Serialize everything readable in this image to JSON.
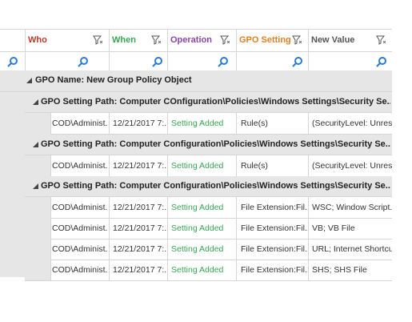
{
  "columns": [
    {
      "label": "Who",
      "color": "#c0392b"
    },
    {
      "label": "When",
      "color": "#3aa655"
    },
    {
      "label": "Operation",
      "color": "#8e44ad"
    },
    {
      "label": "GPO Setting",
      "color": "#e67e22"
    },
    {
      "label": "New Value",
      "color": "#555555"
    }
  ],
  "groups": {
    "gpo_name": "GPO Name: New Group Policy Object",
    "path1": "GPO Setting Path: Computer COnfiguration\\Policies\\Windows Settings\\Security Se...",
    "path2": "GPO Setting Path: Computer Configuration\\Policies\\Windows Settings\\Security Se...",
    "path3": "GPO Setting Path: Computer Configuration\\Policies\\Windows Settings\\Security Se..."
  },
  "rows": [
    {
      "who": "COD\\Administ..",
      "when": "12/21/2017 7:..",
      "operation": "Setting Added",
      "setting": "Rule(s)",
      "value": "(SecurityLevel: Unres..."
    },
    {
      "who": "COD\\Administ..",
      "when": "12/21/2017 7:..",
      "operation": "Setting Added",
      "setting": "Rule(s)",
      "value": "(SecurityLevel: Unres..."
    },
    {
      "who": "COD\\Administ..",
      "when": "12/21/2017 7:..",
      "operation": "Setting Added",
      "setting": "File Extension:Fil...",
      "value": "WSC; Window Script..."
    },
    {
      "who": "COD\\Administ..",
      "when": "12/21/2017 7:..",
      "operation": "Setting Added",
      "setting": "File Extension:Fil...",
      "value": "VB; VB File"
    },
    {
      "who": "COD\\Administ..",
      "when": "12/21/2017 7:..",
      "operation": "Setting Added",
      "setting": "File Extension:Fil...",
      "value": "URL; Internet Shortcut"
    },
    {
      "who": "COD\\Administ..",
      "when": "12/21/2017 7:..",
      "operation": "Setting Added",
      "setting": "File Extension:Fil...",
      "value": "SHS; SHS File"
    }
  ]
}
